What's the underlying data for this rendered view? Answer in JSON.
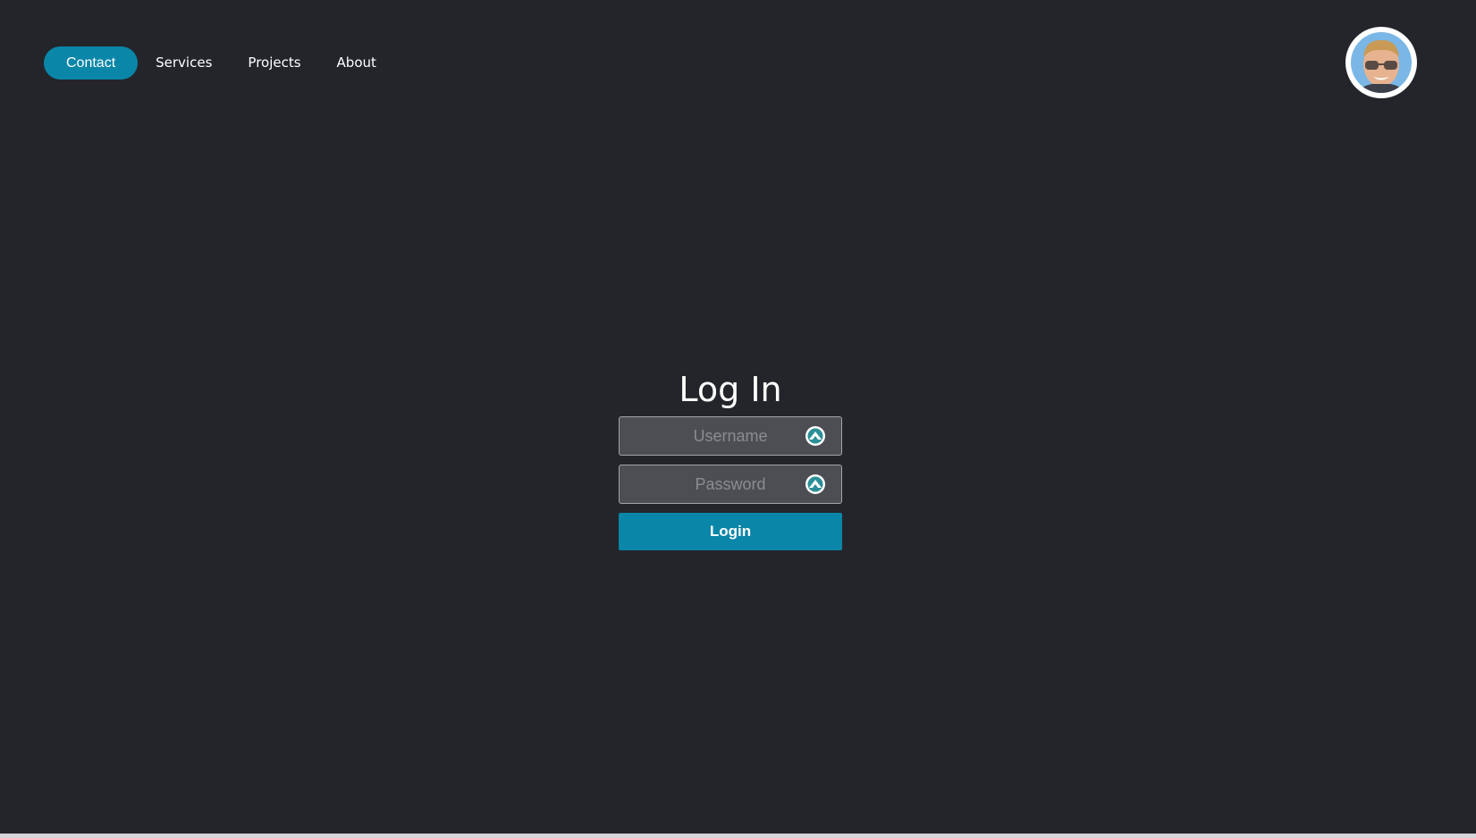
{
  "nav": {
    "items": [
      {
        "label": "Contact",
        "active": true
      },
      {
        "label": "Services",
        "active": false
      },
      {
        "label": "Projects",
        "active": false
      },
      {
        "label": "About",
        "active": false
      }
    ]
  },
  "login": {
    "title": "Log In",
    "username": {
      "value": "",
      "placeholder": "Username",
      "icon": "password-manager-icon"
    },
    "password": {
      "value": "",
      "placeholder": "Password",
      "icon": "password-manager-icon"
    },
    "button_label": "Login"
  },
  "colors": {
    "background": "#23252b",
    "accent": "#0a86a8",
    "field_background": "#4c4e53",
    "text": "#ffffff"
  }
}
